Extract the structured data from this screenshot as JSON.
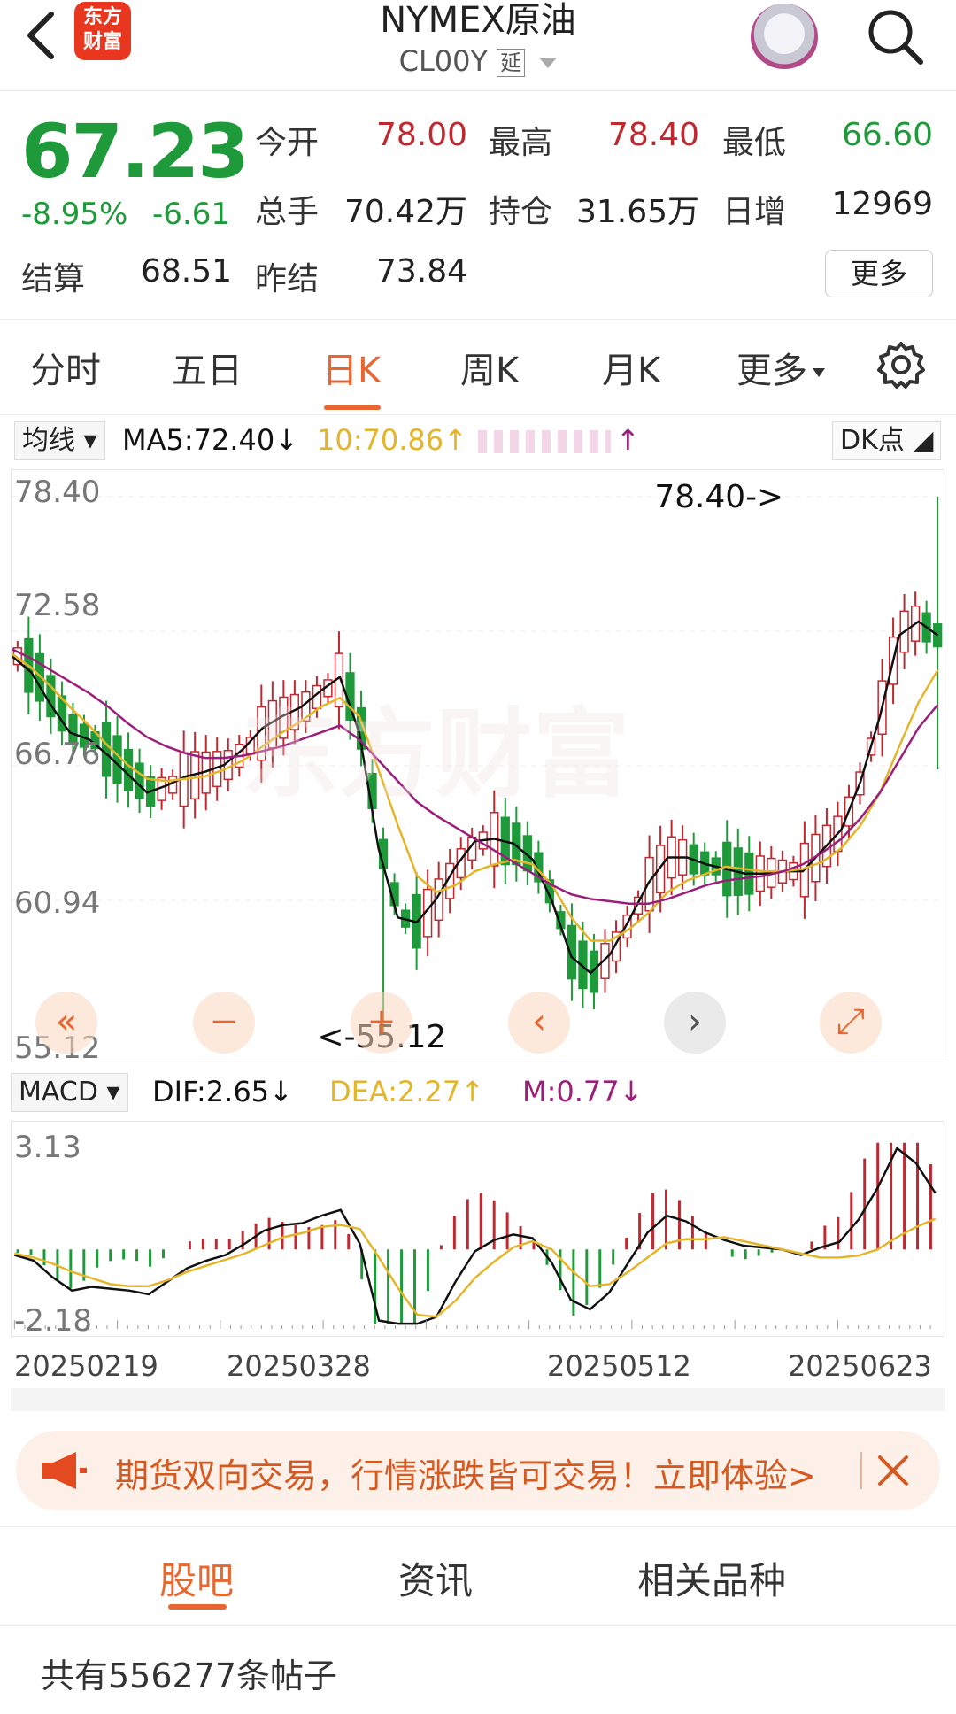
{
  "header": {
    "logo_line1": "东方",
    "logo_line2": "财富",
    "title": "NYMEX原油",
    "code": "CL00Y",
    "delay_badge": "延"
  },
  "quote": {
    "price": "67.23",
    "change_pct": "-8.95%",
    "change_abs": "-6.61",
    "open_label": "今开",
    "open": "78.00",
    "high_label": "最高",
    "high": "78.40",
    "low_label": "最低",
    "low": "66.60",
    "volume_label": "总手",
    "volume": "70.42万",
    "oi_label": "持仓",
    "oi": "31.65万",
    "daily_inc_label": "日增",
    "daily_inc": "12969",
    "settle_label": "结算",
    "settle": "68.51",
    "prev_settle_label": "昨结",
    "prev_settle": "73.84",
    "more_button": "更多"
  },
  "tabs": {
    "items": [
      "分时",
      "五日",
      "日K",
      "周K",
      "月K",
      "更多"
    ],
    "active": "日K"
  },
  "indicator_bar": {
    "ma_dropdown": "均线",
    "ma5": "MA5:72.40",
    "ma10": "10:70.86",
    "dk_button": "DK点",
    "macd_dropdown": "MACD",
    "dif": "DIF:2.65",
    "dea": "DEA:2.27",
    "m": "M:0.77"
  },
  "colors": {
    "up": "#c0282f",
    "down": "#1f9a3a",
    "ma5": "#111111",
    "ma10": "#e4b52a",
    "ma20": "#9b1f7a",
    "accent": "#e8662f"
  },
  "chart_data": {
    "type": "candlestick",
    "y_labels": [
      "78.40",
      "72.58",
      "66.76",
      "60.94",
      "55.12"
    ],
    "ylim": [
      55.12,
      78.4
    ],
    "high_marker": "78.40->",
    "low_marker": "<-55.12",
    "x_labels": [
      "20250219",
      "20250328",
      "20250512",
      "20250623"
    ],
    "macd_y_labels": [
      "3.13",
      "-2.18"
    ],
    "macd_ylim": [
      -2.18,
      3.13
    ],
    "ma5_path": [
      71.5,
      70.8,
      69.4,
      68.2,
      67.9,
      67.2,
      66.4,
      65.6,
      65.9,
      66.3,
      66.5,
      66.8,
      67.5,
      68.4,
      68.9,
      69.3,
      70.0,
      70.6,
      68.2,
      63.2,
      60.2,
      60.0,
      61.0,
      62.4,
      63.5,
      63.6,
      63.4,
      62.7,
      60.9,
      58.5,
      57.8,
      58.6,
      60.1,
      61.7,
      62.8,
      62.8,
      62.5,
      62.3,
      62.1,
      62.1,
      62.2,
      62.2,
      63.1,
      64.0,
      66.1,
      68.9,
      72.4,
      73.0,
      72.4
    ],
    "ma10_path": [
      71.6,
      71.0,
      70.2,
      69.3,
      68.5,
      67.6,
      66.8,
      66.2,
      66.1,
      66.2,
      66.3,
      66.6,
      67.0,
      67.6,
      68.2,
      68.7,
      69.3,
      69.7,
      68.9,
      66.6,
      64.2,
      62.0,
      61.3,
      61.6,
      62.2,
      62.5,
      62.7,
      62.5,
      61.6,
      60.2,
      59.2,
      59.2,
      59.7,
      60.4,
      61.3,
      61.8,
      62.1,
      62.4,
      62.3,
      62.2,
      62.2,
      62.3,
      62.6,
      63.2,
      64.2,
      65.6,
      67.6,
      69.5,
      70.9
    ],
    "ma20_path": [
      71.8,
      71.4,
      70.9,
      70.4,
      69.9,
      69.3,
      68.6,
      68.0,
      67.6,
      67.3,
      67.1,
      67.1,
      67.2,
      67.4,
      67.6,
      67.9,
      68.2,
      68.5,
      67.9,
      67.0,
      66.1,
      65.2,
      64.6,
      64.1,
      63.6,
      63.1,
      62.6,
      62.1,
      61.6,
      61.2,
      61.0,
      60.9,
      60.8,
      60.8,
      61.0,
      61.3,
      61.6,
      61.8,
      61.9,
      62.0,
      62.2,
      62.5,
      63.0,
      63.6,
      64.5,
      65.6,
      67.0,
      68.4,
      69.4
    ]
  },
  "banner": {
    "text": "期货双向交易，行情涨跌皆可交易！立即体验>"
  },
  "bottom_tabs": {
    "items": [
      "股吧",
      "资讯",
      "相关品种"
    ],
    "active": "股吧"
  },
  "posts_count": "共有556277条帖子"
}
